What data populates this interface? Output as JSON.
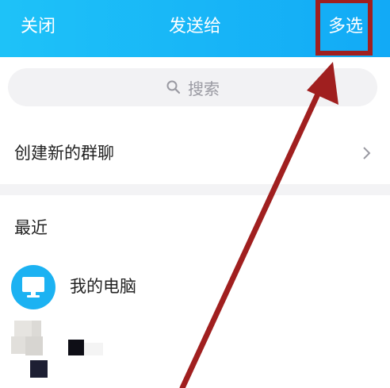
{
  "header": {
    "close_label": "关闭",
    "title": "发送给",
    "multi_select_label": "多选",
    "background_color": "#14b0f7"
  },
  "search": {
    "placeholder": "搜索",
    "icon": "search-icon"
  },
  "create_group": {
    "label": "创建新的群聊",
    "icon": "chevron-right-icon"
  },
  "recent": {
    "title": "最近",
    "contacts": [
      {
        "name": "我的电脑",
        "avatar_icon": "computer-monitor-icon",
        "avatar_color": "#1cb2f2"
      }
    ]
  },
  "annotation": {
    "highlight_color": "#a01f1f",
    "arrow_icon": "arrow-pointer-icon"
  }
}
